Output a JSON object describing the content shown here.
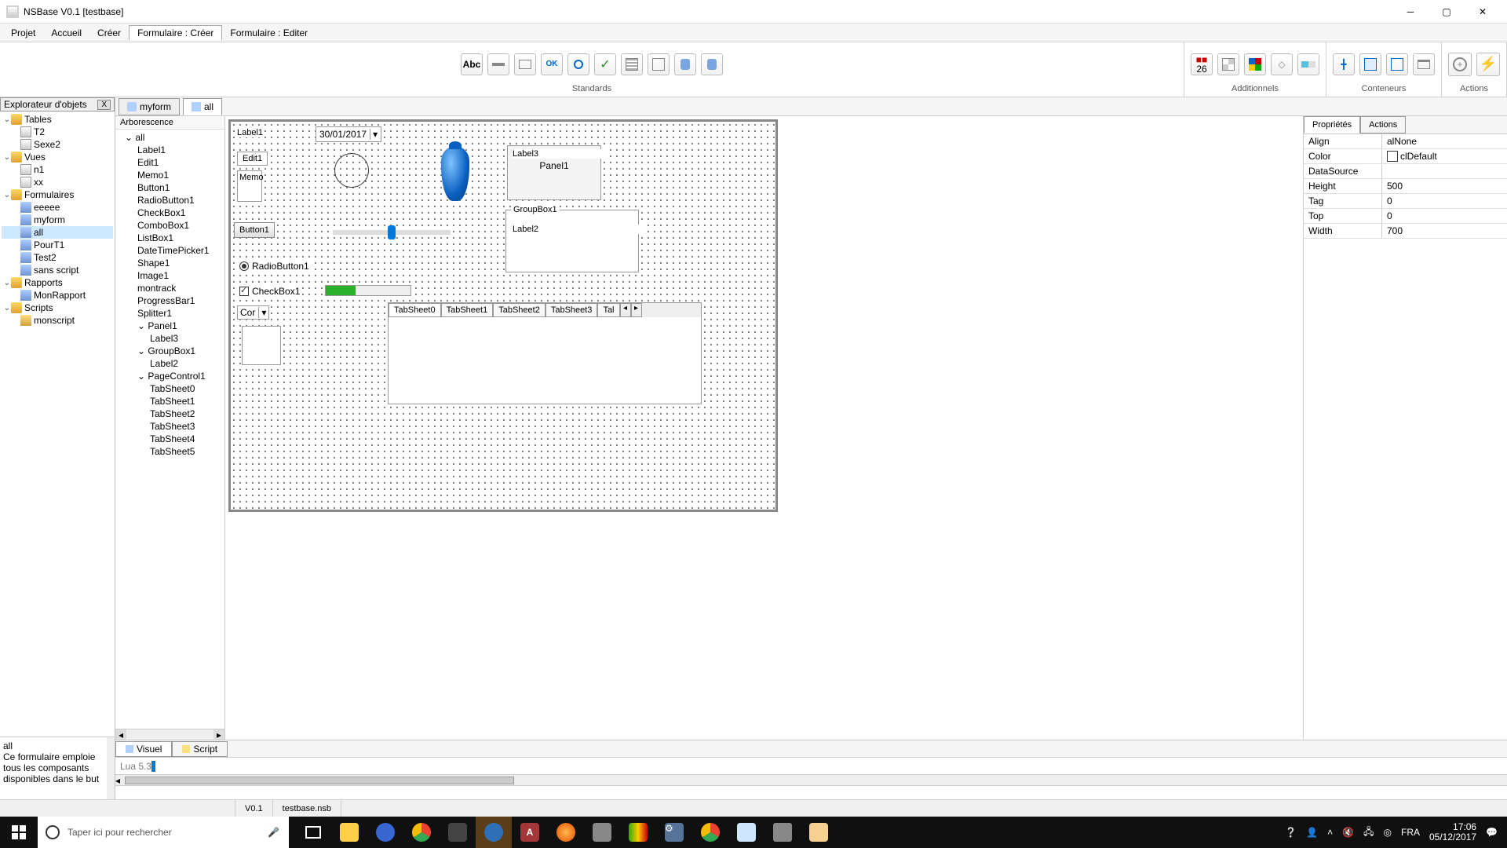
{
  "title": "NSBase V0.1 [testbase]",
  "menus": {
    "projet": "Projet",
    "accueil": "Accueil",
    "creer": "Créer",
    "form_creer": "Formulaire : Créer",
    "form_editer": "Formulaire : Editer"
  },
  "ribbon": {
    "standards": "Standards",
    "additionnels": "Additionnels",
    "conteneurs": "Conteneurs",
    "actions": "Actions",
    "std_label_abc": "Abc",
    "std_btn_ok": "OK",
    "add_cal_day": "26"
  },
  "explorer": {
    "header": "Explorateur d'objets",
    "close": "X",
    "tables": "Tables",
    "t2": "T2",
    "sexe2": "Sexe2",
    "vues": "Vues",
    "n1": "n1",
    "xx": "xx",
    "formulaires": "Formulaires",
    "eeeee": "eeeee",
    "myform": "myform",
    "all": "all",
    "pourt1": "PourT1",
    "test2": "Test2",
    "sans_script": "sans script",
    "rapports": "Rapports",
    "monrapport": "MonRapport",
    "scripts": "Scripts",
    "monscript": "monscript",
    "info_title": "all",
    "info_body": "Ce formulaire emploie tous les composants disponibles dans le but"
  },
  "form_tabs": {
    "tab1": "myform",
    "tab2": "all"
  },
  "arbo": {
    "header": "Arborescence",
    "root": "all",
    "label1": "Label1",
    "edit1": "Edit1",
    "memo1": "Memo1",
    "button1": "Button1",
    "radiobutton1": "RadioButton1",
    "checkbox1": "CheckBox1",
    "combobox1": "ComboBox1",
    "listbox1": "ListBox1",
    "datetimepicker1": "DateTimePicker1",
    "shape1": "Shape1",
    "image1": "Image1",
    "montrack": "montrack",
    "progressbar1": "ProgressBar1",
    "splitter1": "Splitter1",
    "panel1": "Panel1",
    "label3": "Label3",
    "groupbox1": "GroupBox1",
    "label2": "Label2",
    "pagecontrol1": "PageControl1",
    "ts0": "TabSheet0",
    "ts1": "TabSheet1",
    "ts2": "TabSheet2",
    "ts3": "TabSheet3",
    "ts4": "TabSheet4",
    "ts5": "TabSheet5"
  },
  "design": {
    "label1": "Label1",
    "date_value": "30/01/2017",
    "edit1": "Edit1",
    "memo": "Memo",
    "button1": "Button1",
    "radiobutton1": "RadioButton1",
    "checkbox1": "CheckBox1",
    "combo_text": "Cor",
    "label3": "Label3",
    "panel1": "Panel1",
    "groupbox1": "GroupBox1",
    "label2": "Label2",
    "tabs": {
      "t0": "TabSheet0",
      "t1": "TabSheet1",
      "t2": "TabSheet2",
      "t3": "TabSheet3",
      "t4": "Tal"
    },
    "nav_prev": "◂",
    "nav_next": "▸"
  },
  "props": {
    "tab1": "Propriétés",
    "tab2": "Actions",
    "align": {
      "name": "Align",
      "value": "alNone"
    },
    "color": {
      "name": "Color",
      "value": "clDefault"
    },
    "datasource": {
      "name": "DataSource",
      "value": ""
    },
    "height": {
      "name": "Height",
      "value": "500"
    },
    "tag": {
      "name": "Tag",
      "value": "0"
    },
    "top": {
      "name": "Top",
      "value": "0"
    },
    "width": {
      "name": "Width",
      "value": "700"
    }
  },
  "bottom_tabs": {
    "visuel": "Visuel",
    "script": "Script"
  },
  "lua": "Lua 5.3",
  "status": {
    "version": "V0.1",
    "file": "testbase.nsb"
  },
  "taskbar": {
    "search_placeholder": "Taper ici pour rechercher",
    "lang": "FRA",
    "time": "17:06",
    "date": "05/12/2017"
  }
}
